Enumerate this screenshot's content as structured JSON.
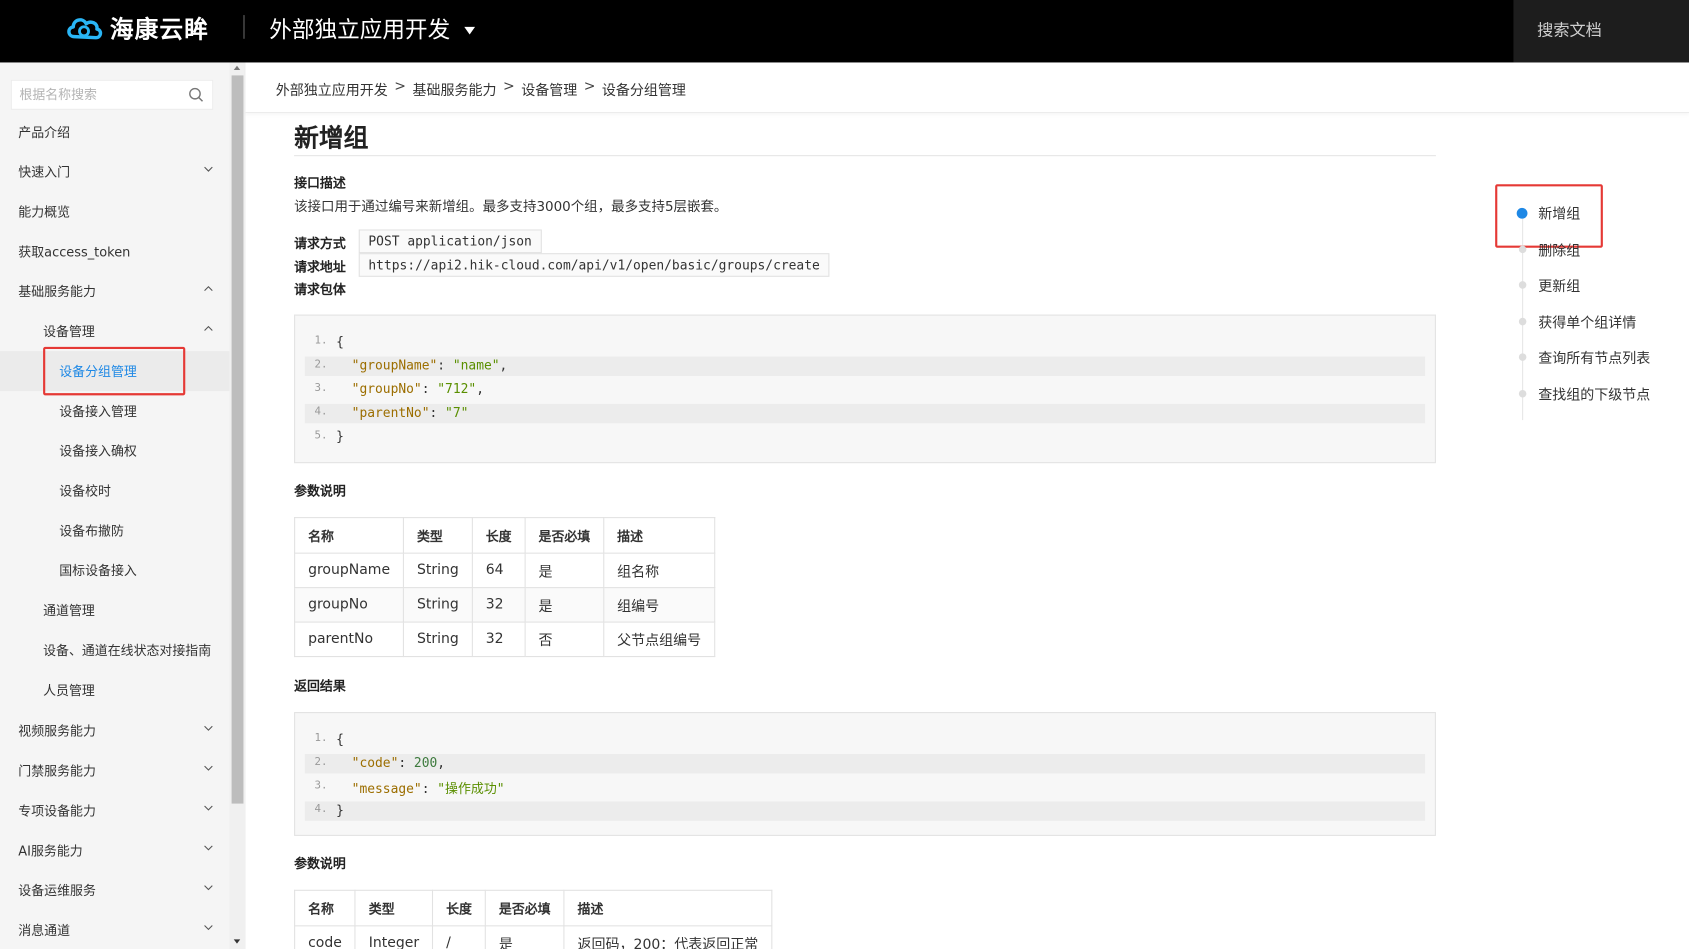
{
  "header": {
    "logo_text": "海康云眸",
    "app_name": "外部独立应用开发",
    "search_docs": "搜索文档"
  },
  "sidebar": {
    "search_placeholder": "根据名称搜索",
    "items": [
      {
        "label": "产品介绍"
      },
      {
        "label": "快速入门"
      },
      {
        "label": "能力概览"
      },
      {
        "label": "获取access_token"
      },
      {
        "label": "基础服务能力"
      },
      {
        "label": "设备管理"
      },
      {
        "label": "设备分组管理"
      },
      {
        "label": "设备接入管理"
      },
      {
        "label": "设备接入确权"
      },
      {
        "label": "设备校时"
      },
      {
        "label": "设备布撤防"
      },
      {
        "label": "国标设备接入"
      },
      {
        "label": "通道管理"
      },
      {
        "label": "设备、通道在线状态对接指南"
      },
      {
        "label": "人员管理"
      },
      {
        "label": "视频服务能力"
      },
      {
        "label": "门禁服务能力"
      },
      {
        "label": "专项设备能力"
      },
      {
        "label": "AI服务能力"
      },
      {
        "label": "设备运维服务"
      },
      {
        "label": "消息通道"
      }
    ]
  },
  "breadcrumb": [
    "外部独立应用开发",
    "基础服务能力",
    "设备管理",
    "设备分组管理"
  ],
  "breadcrumb_separator": ">",
  "content": {
    "title": "新增组",
    "api_desc_label": "接口描述",
    "api_desc": "该接口用于通过编号来新增组。最多支持3000个组，最多支持5层嵌套。",
    "method_label": "请求方式",
    "method_value": "POST application/json",
    "url_label": "请求地址",
    "url_value": "https://api2.hik-cloud.com/api/v1/open/basic/groups/create",
    "body_label": "请求包体",
    "request_code": [
      {
        "n": "1.",
        "t": "{"
      },
      {
        "n": "2.",
        "k": "\"groupName\"",
        "v": "\"name\"",
        "end": ","
      },
      {
        "n": "3.",
        "k": "\"groupNo\"",
        "v": "\"712\"",
        "end": ","
      },
      {
        "n": "4.",
        "k": "\"parentNo\"",
        "v": "\"7\"",
        "end": ""
      },
      {
        "n": "5.",
        "t": "}"
      }
    ],
    "params_label": "参数说明",
    "param_headers": [
      "名称",
      "类型",
      "长度",
      "是否必填",
      "描述"
    ],
    "params": [
      [
        "groupName",
        "String",
        "64",
        "是",
        "组名称"
      ],
      [
        "groupNo",
        "String",
        "32",
        "是",
        "组编号"
      ],
      [
        "parentNo",
        "String",
        "32",
        "否",
        "父节点组编号"
      ]
    ],
    "return_label": "返回结果",
    "response_code": [
      {
        "n": "1.",
        "t": "{"
      },
      {
        "n": "2.",
        "k": "\"code\"",
        "v": "200",
        "end": ","
      },
      {
        "n": "3.",
        "k": "\"message\"",
        "v": "\"操作成功\"",
        "end": ""
      },
      {
        "n": "4.",
        "t": "}"
      }
    ],
    "params2_label": "参数说明",
    "param2_headers": [
      "名称",
      "类型",
      "长度",
      "是否必填",
      "描述"
    ],
    "params2": [
      [
        "code",
        "Integer",
        "/",
        "是",
        "返回码，200：代表返回正常"
      ]
    ]
  },
  "toc": {
    "items": [
      "新增组",
      "删除组",
      "更新组",
      "获得单个组详情",
      "查询所有节点列表",
      "查找组的下级节点"
    ],
    "active_index": 0
  },
  "colors": {
    "accent": "#1e88e5",
    "highlight_box": "#e53935",
    "topbar": "#000000"
  }
}
